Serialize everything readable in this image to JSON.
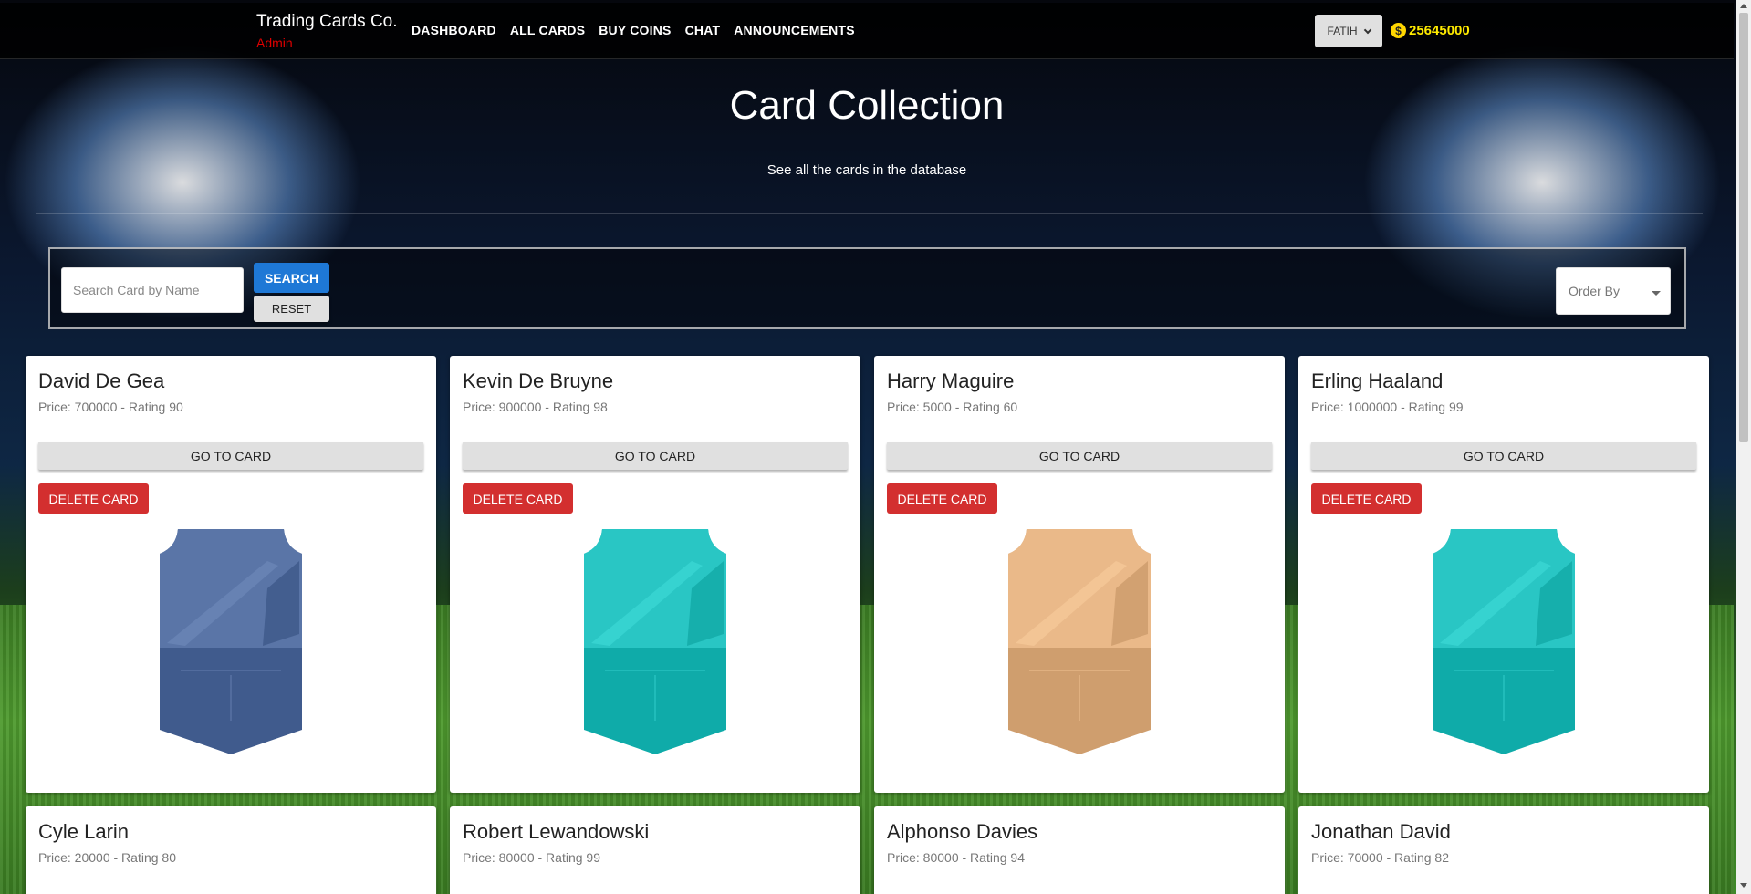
{
  "navbar": {
    "brand": "Trading Cards Co.",
    "role": "Admin",
    "links": [
      "DASHBOARD",
      "ALL CARDS",
      "BUY COINS",
      "CHAT",
      "ANNOUNCEMENTS"
    ],
    "user": "FATIH",
    "coins": "25645000"
  },
  "hero": {
    "title": "Card Collection",
    "subtitle": "See all the cards in the database"
  },
  "search": {
    "placeholder": "Search Card by Name",
    "search_label": "SEARCH",
    "reset_label": "RESET",
    "order_by": "Order By"
  },
  "card_actions": {
    "go_label": "GO TO CARD",
    "delete_label": "DELETE CARD"
  },
  "cards": [
    {
      "name": "David De Gea",
      "meta": "Price: 700000 - Rating 90",
      "color": "#4a6597"
    },
    {
      "name": "Kevin De Bruyne",
      "meta": "Price: 900000 - Rating 98",
      "color": "#19b5b3"
    },
    {
      "name": "Harry Maguire",
      "meta": "Price: 5000 - Rating 60",
      "color": "#d9a878"
    },
    {
      "name": "Erling Haaland",
      "meta": "Price: 1000000 - Rating 99",
      "color": "#19b5b3"
    },
    {
      "name": "Cyle Larin",
      "meta": "Price: 20000 - Rating 80",
      "color": ""
    },
    {
      "name": "Robert Lewandowski",
      "meta": "Price: 80000 - Rating 99",
      "color": ""
    },
    {
      "name": "Alphonso Davies",
      "meta": "Price: 80000 - Rating 94",
      "color": ""
    },
    {
      "name": "Jonathan David",
      "meta": "Price: 70000 - Rating 82",
      "color": ""
    }
  ]
}
